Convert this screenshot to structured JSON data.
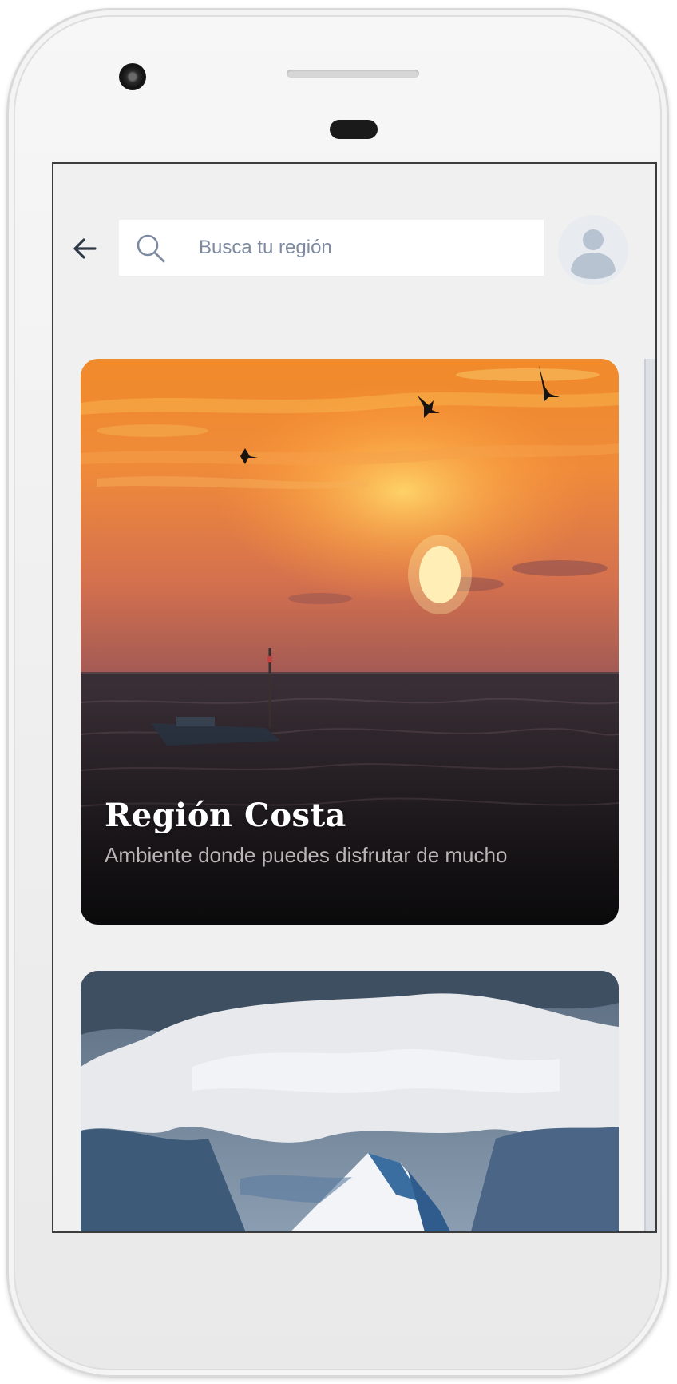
{
  "search": {
    "placeholder": "Busca tu región",
    "value": ""
  },
  "icons": {
    "back": "arrow-left-icon",
    "search": "magnifier-icon",
    "avatar": "user-avatar-icon"
  },
  "regions": [
    {
      "title": "Región Costa",
      "subtitle": "Ambiente donde puedes disfrutar de mucho"
    }
  ],
  "colors": {
    "screen_bg": "#f0f0f0",
    "search_bg": "#ffffff",
    "placeholder": "#7d8aa0",
    "avatar_bg": "#e8ebf0",
    "avatar_fg": "#b8c3d1",
    "card_title": "#ffffff",
    "card_subtitle": "#b9b4b6"
  }
}
